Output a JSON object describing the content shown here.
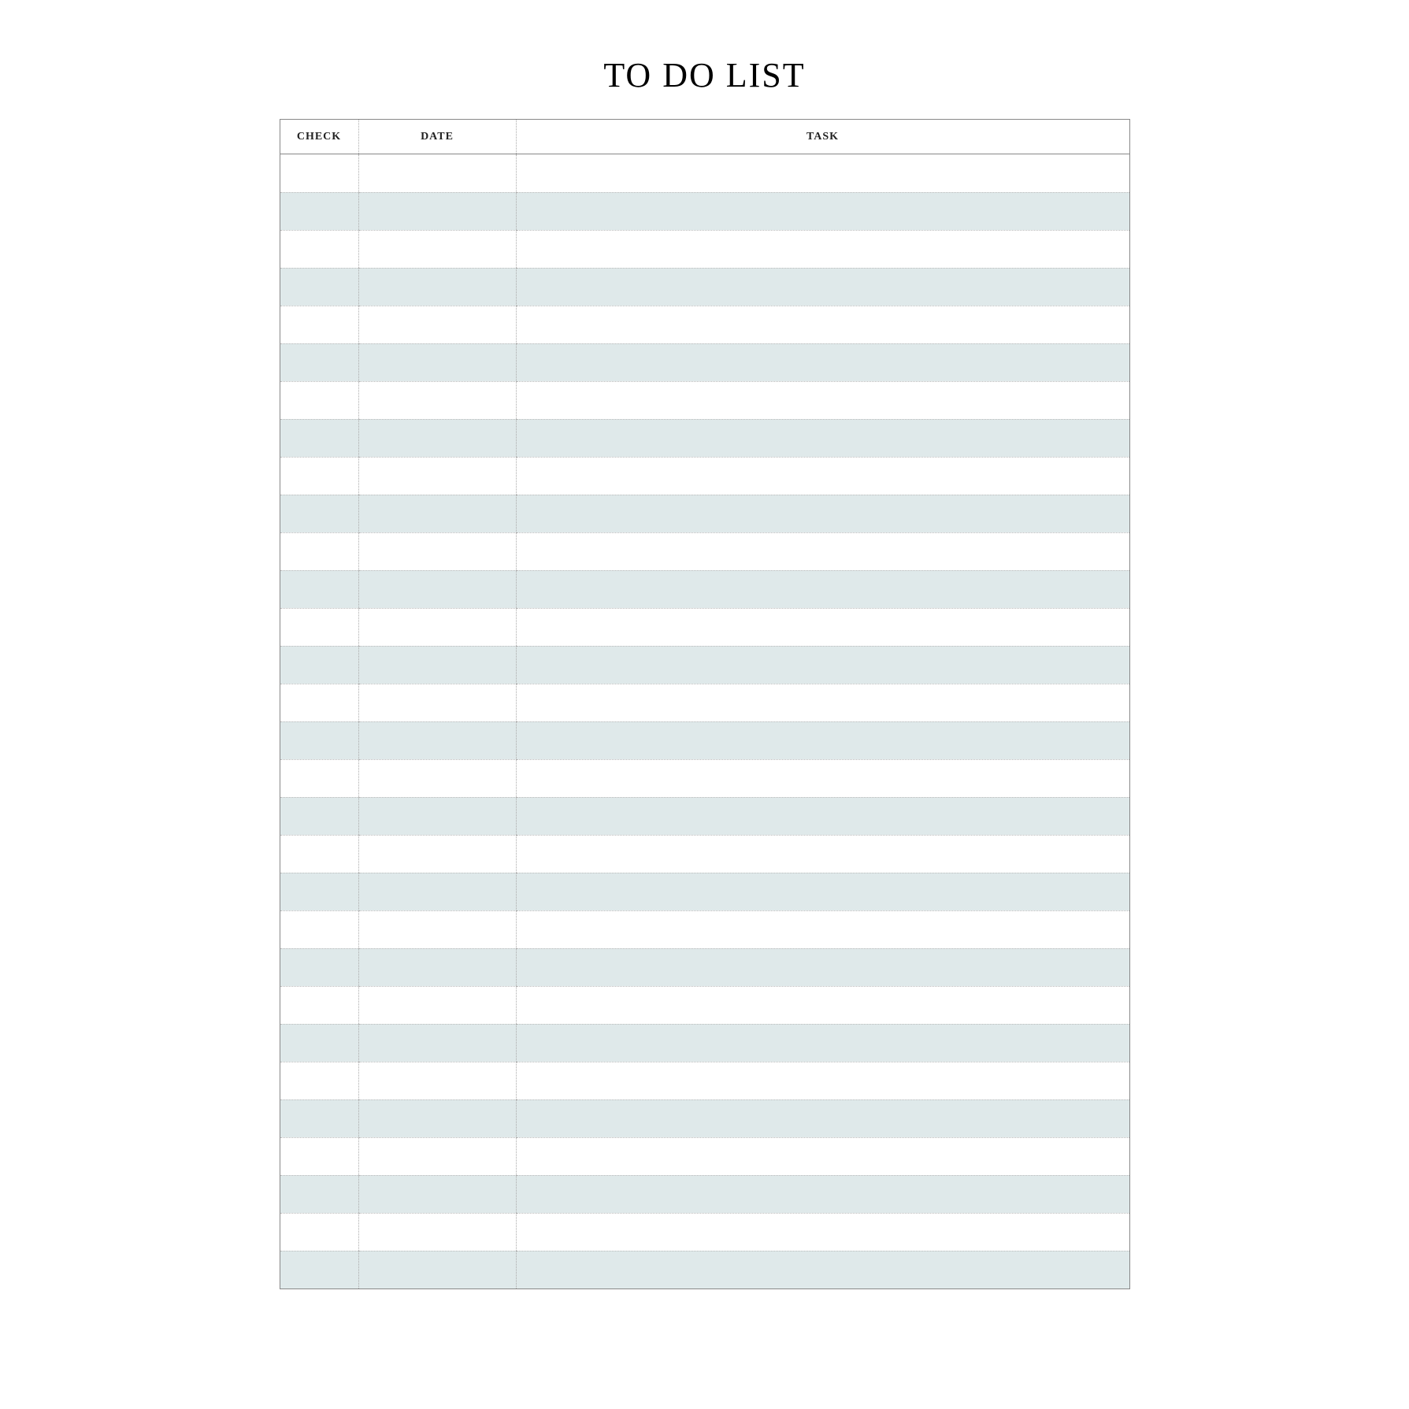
{
  "title": "TO DO LIST",
  "columns": {
    "check": "CHECK",
    "date": "DATE",
    "task": "TASK"
  },
  "rows": [
    {
      "check": "",
      "date": "",
      "task": ""
    },
    {
      "check": "",
      "date": "",
      "task": ""
    },
    {
      "check": "",
      "date": "",
      "task": ""
    },
    {
      "check": "",
      "date": "",
      "task": ""
    },
    {
      "check": "",
      "date": "",
      "task": ""
    },
    {
      "check": "",
      "date": "",
      "task": ""
    },
    {
      "check": "",
      "date": "",
      "task": ""
    },
    {
      "check": "",
      "date": "",
      "task": ""
    },
    {
      "check": "",
      "date": "",
      "task": ""
    },
    {
      "check": "",
      "date": "",
      "task": ""
    },
    {
      "check": "",
      "date": "",
      "task": ""
    },
    {
      "check": "",
      "date": "",
      "task": ""
    },
    {
      "check": "",
      "date": "",
      "task": ""
    },
    {
      "check": "",
      "date": "",
      "task": ""
    },
    {
      "check": "",
      "date": "",
      "task": ""
    },
    {
      "check": "",
      "date": "",
      "task": ""
    },
    {
      "check": "",
      "date": "",
      "task": ""
    },
    {
      "check": "",
      "date": "",
      "task": ""
    },
    {
      "check": "",
      "date": "",
      "task": ""
    },
    {
      "check": "",
      "date": "",
      "task": ""
    },
    {
      "check": "",
      "date": "",
      "task": ""
    },
    {
      "check": "",
      "date": "",
      "task": ""
    },
    {
      "check": "",
      "date": "",
      "task": ""
    },
    {
      "check": "",
      "date": "",
      "task": ""
    },
    {
      "check": "",
      "date": "",
      "task": ""
    },
    {
      "check": "",
      "date": "",
      "task": ""
    },
    {
      "check": "",
      "date": "",
      "task": ""
    },
    {
      "check": "",
      "date": "",
      "task": ""
    },
    {
      "check": "",
      "date": "",
      "task": ""
    },
    {
      "check": "",
      "date": "",
      "task": ""
    }
  ]
}
